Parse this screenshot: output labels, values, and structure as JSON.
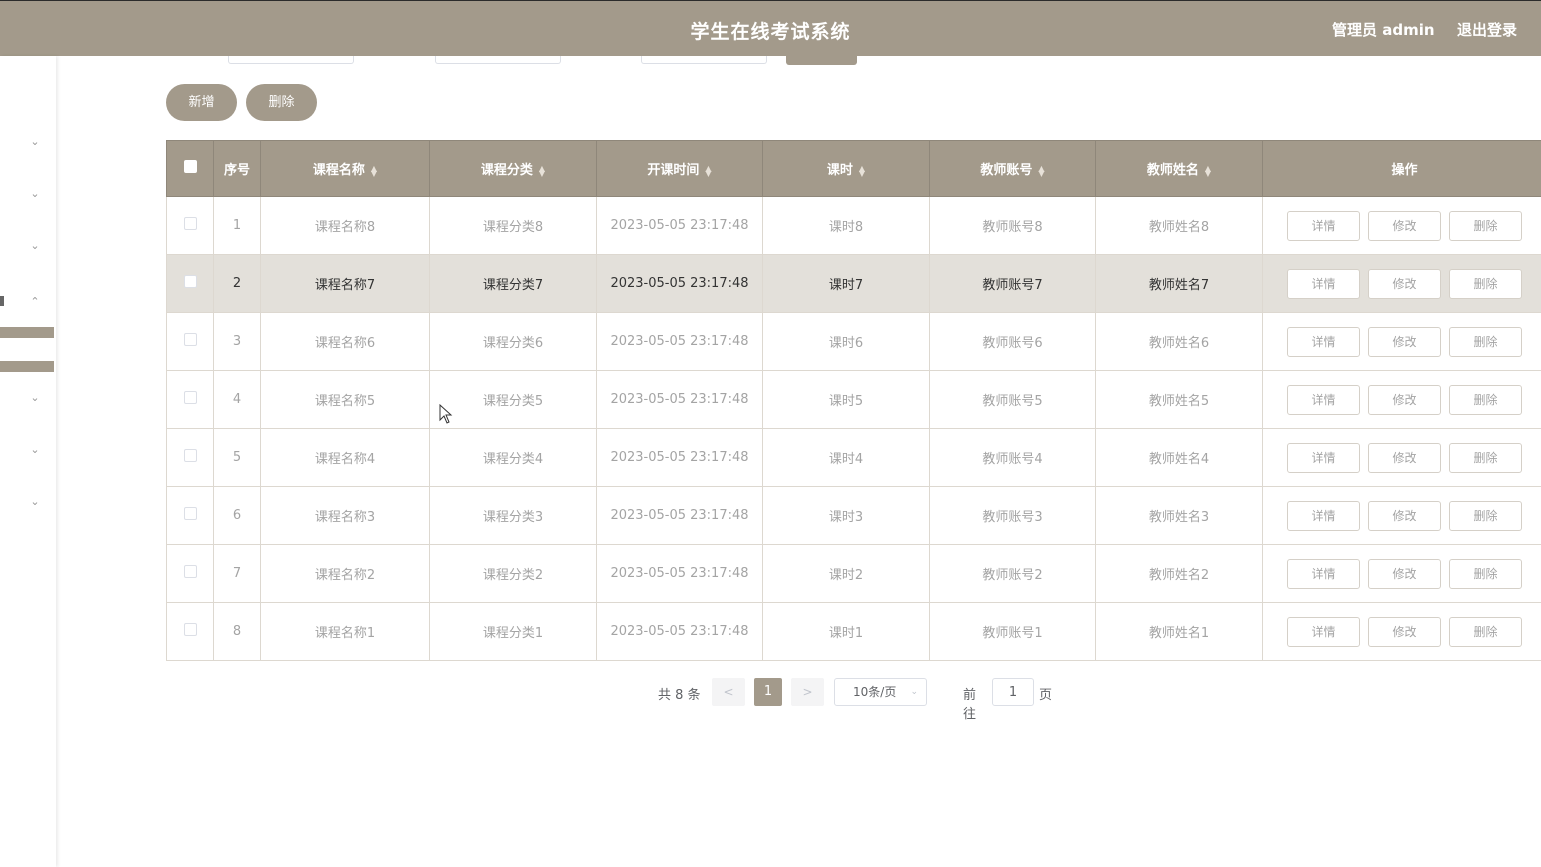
{
  "header": {
    "title": "学生在线考试系统",
    "user_label": "管理员 admin",
    "logout_label": "退出登录"
  },
  "sidebar": {
    "icons": [
      "chevron-down-icon",
      "chevron-down-icon",
      "chevron-down-icon",
      "chevron-up-icon",
      "chevron-down-icon",
      "chevron-down-icon",
      "chevron-down-icon"
    ]
  },
  "actions": {
    "add_label": "新增",
    "delete_label": "删除"
  },
  "table": {
    "columns": [
      "序号",
      "课程名称",
      "课程分类",
      "开课时间",
      "课时",
      "教师账号",
      "教师姓名",
      "操作"
    ],
    "row_buttons": [
      "详情",
      "修改",
      "删除"
    ],
    "rows": [
      [
        "1",
        "课程名称8",
        "课程分类8",
        "2023-05-05 23:17:48",
        "课时8",
        "教师账号8",
        "教师姓名8"
      ],
      [
        "2",
        "课程名称7",
        "课程分类7",
        "2023-05-05 23:17:48",
        "课时7",
        "教师账号7",
        "教师姓名7"
      ],
      [
        "3",
        "课程名称6",
        "课程分类6",
        "2023-05-05 23:17:48",
        "课时6",
        "教师账号6",
        "教师姓名6"
      ],
      [
        "4",
        "课程名称5",
        "课程分类5",
        "2023-05-05 23:17:48",
        "课时5",
        "教师账号5",
        "教师姓名5"
      ],
      [
        "5",
        "课程名称4",
        "课程分类4",
        "2023-05-05 23:17:48",
        "课时4",
        "教师账号4",
        "教师姓名4"
      ],
      [
        "6",
        "课程名称3",
        "课程分类3",
        "2023-05-05 23:17:48",
        "课时3",
        "教师账号3",
        "教师姓名3"
      ],
      [
        "7",
        "课程名称2",
        "课程分类2",
        "2023-05-05 23:17:48",
        "课时2",
        "教师账号2",
        "教师姓名2"
      ],
      [
        "8",
        "课程名称1",
        "课程分类1",
        "2023-05-05 23:17:48",
        "课时1",
        "教师账号1",
        "教师姓名1"
      ]
    ],
    "highlighted_row": 1
  },
  "pagination": {
    "total": "共 8 条",
    "prev": "<",
    "current_page": "1",
    "next": ">",
    "page_size": "10条/页",
    "goto_label": "前往",
    "goto_value": "1",
    "page_suffix": "页"
  },
  "colors": {
    "accent": "#a39a8b",
    "highlight_row": "#e3e0da"
  }
}
